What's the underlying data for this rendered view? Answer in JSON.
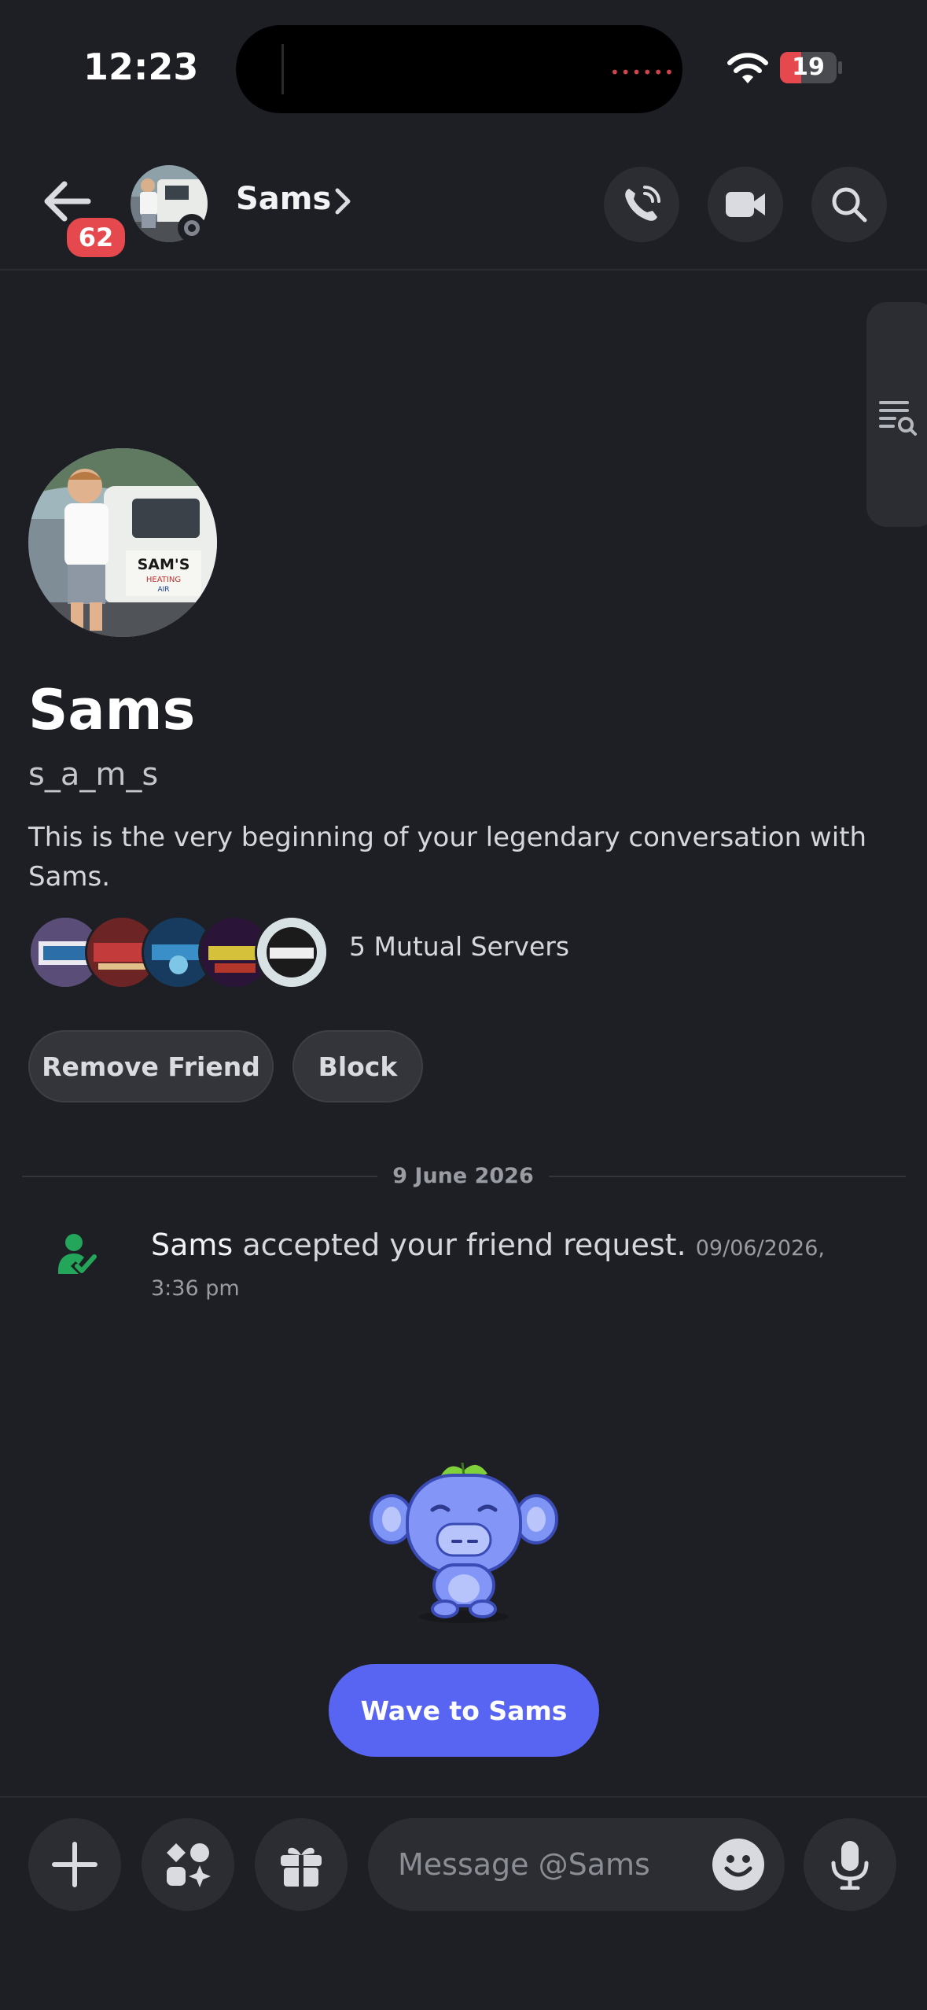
{
  "status_bar": {
    "time": "12:23",
    "battery": "19"
  },
  "header": {
    "back_badge": "62",
    "name": "Sams",
    "actions": [
      "phone-call",
      "video-call",
      "search"
    ]
  },
  "profile": {
    "display_name": "Sams",
    "username": "s_a_m_s",
    "intro": "This is the very beginning of your legendary conversation with Sams.",
    "mutual_servers_label": "5 Mutual Servers",
    "buttons": {
      "remove_friend": "Remove Friend",
      "block": "Block"
    }
  },
  "messages": {
    "date_divider": "9 June 2026",
    "system": {
      "actor": "Sams",
      "text": "accepted your friend request.",
      "timestamp": "09/06/2026, 3:36 pm"
    }
  },
  "wave_button": "Wave to Sams",
  "composer": {
    "placeholder": "Message @Sams"
  },
  "colors": {
    "background": "#1e1f24",
    "accent": "#5865f2",
    "badge": "#e5484d",
    "online_green": "#23a55a"
  }
}
